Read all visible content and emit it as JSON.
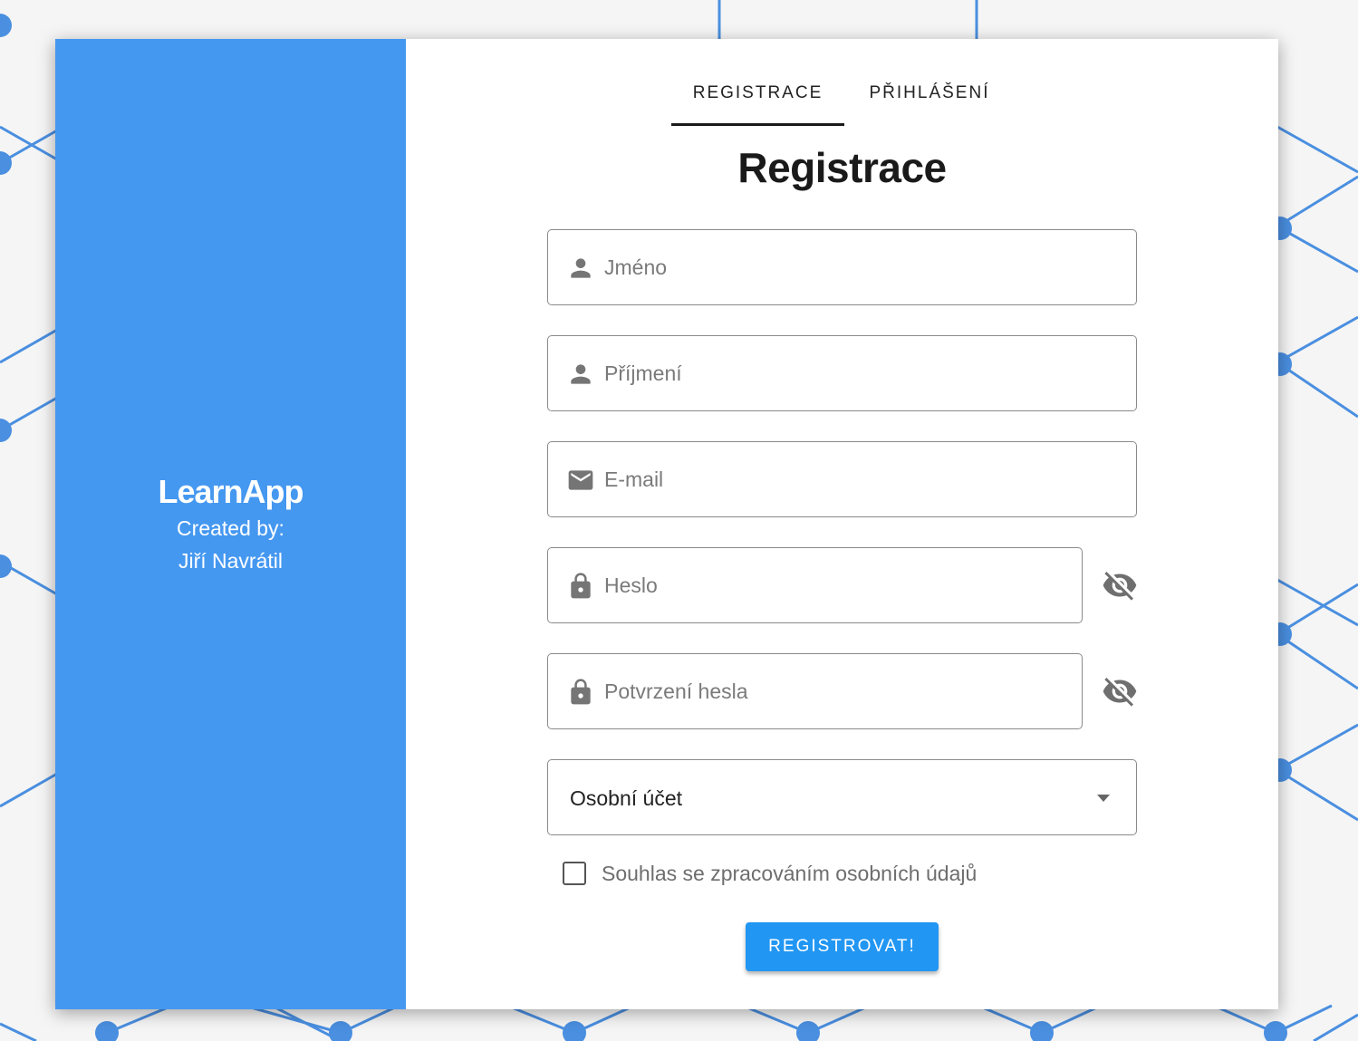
{
  "brand": {
    "app_name": "LearnApp",
    "created_by_label": "Created by:",
    "author": "Jiří Navrátil",
    "color": "#4598f0"
  },
  "tabs": [
    {
      "label": "REGISTRACE",
      "active": true
    },
    {
      "label": "PŘIHLÁŠENÍ",
      "active": false
    }
  ],
  "form": {
    "title": "Registrace",
    "fields": {
      "first_name": {
        "placeholder": "Jméno",
        "value": "",
        "icon": "person-icon"
      },
      "last_name": {
        "placeholder": "Příjmení",
        "value": "",
        "icon": "person-icon"
      },
      "email": {
        "placeholder": "E-mail",
        "value": "",
        "icon": "mail-icon"
      },
      "password": {
        "placeholder": "Heslo",
        "value": "",
        "icon": "lock-icon",
        "toggle_icon": "visibility-off-icon"
      },
      "password_confirm": {
        "placeholder": "Potvrzení hesla",
        "value": "",
        "icon": "lock-icon",
        "toggle_icon": "visibility-off-icon"
      }
    },
    "account_type": {
      "selected": "Osobní účet",
      "icon": "caret-down-icon"
    },
    "consent": {
      "label": "Souhlas se zpracováním osobních údajů",
      "checked": false
    },
    "submit_label": "REGISTROVAT!",
    "accent_color": "#2196f3"
  }
}
